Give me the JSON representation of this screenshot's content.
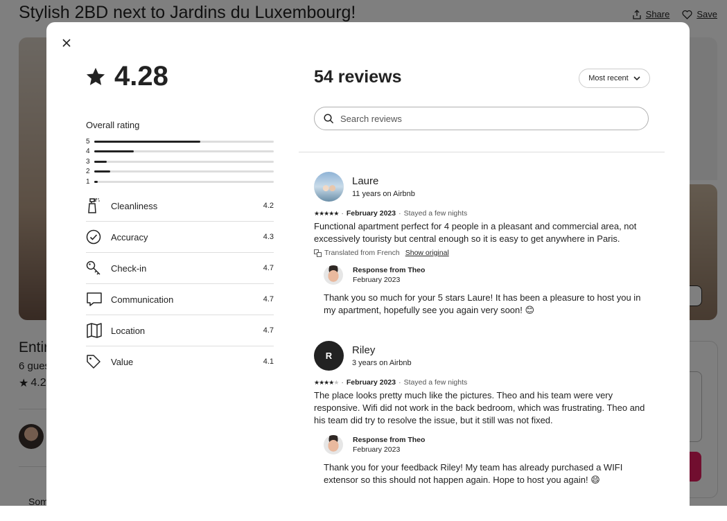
{
  "listing": {
    "title": "Stylish 2BD next to Jardins du Luxembourg!",
    "share_label": "Share",
    "save_label": "Save",
    "heading_partial": "Entir",
    "guests_partial": "6 gues",
    "rating_partial": "4.2",
    "bottom_partial": "Som"
  },
  "modal": {
    "overall_score": "4.28",
    "overall_label": "Overall rating",
    "distribution": [
      {
        "stars": "5",
        "fraction": 0.59
      },
      {
        "stars": "4",
        "fraction": 0.22
      },
      {
        "stars": "3",
        "fraction": 0.07
      },
      {
        "stars": "2",
        "fraction": 0.09
      },
      {
        "stars": "1",
        "fraction": 0.02
      }
    ],
    "categories": [
      {
        "label": "Cleanliness",
        "value": "4.2",
        "icon": "spray-bottle-icon"
      },
      {
        "label": "Accuracy",
        "value": "4.3",
        "icon": "check-circle-icon"
      },
      {
        "label": "Check-in",
        "value": "4.7",
        "icon": "key-icon"
      },
      {
        "label": "Communication",
        "value": "4.7",
        "icon": "chat-bubble-icon"
      },
      {
        "label": "Location",
        "value": "4.7",
        "icon": "map-icon"
      },
      {
        "label": "Value",
        "value": "4.1",
        "icon": "tag-icon"
      }
    ],
    "reviews_title": "54 reviews",
    "sort_label": "Most recent",
    "search_placeholder": "Search reviews",
    "reviews": [
      {
        "name": "Laure",
        "tenure": "11 years on Airbnb",
        "stars": 5,
        "date": "February 2023",
        "stay": "Stayed a few nights",
        "text": "Functional apartment perfect for 4 people in a pleasant and commercial area, not excessively touristy but central enough so it is easy to get anywhere in Paris.",
        "translated": "Translated from French",
        "show_original": "Show original",
        "response_title": "Response from Theo",
        "response_date": "February 2023",
        "response_text": "Thank you so much for your 5 stars Laure! It has been a pleasure to host you in my apartment, hopefully see you again very soon! 😊"
      },
      {
        "name": "Riley",
        "initial": "R",
        "tenure": "3 years on Airbnb",
        "stars": 4,
        "date": "February 2023",
        "stay": "Stayed a few nights",
        "text": "The place looks pretty much like the pictures. Theo and his team were very responsive. Wifi did not work in the back bedroom, which was frustrating. Theo and his team did try to resolve the issue, but it still was not fixed.",
        "response_title": "Response from Theo",
        "response_date": "February 2023",
        "response_text": "Thank you for your feedback Riley! My team has already purchased a WIFI extensor so this should not happen again. Hope to host you again! 😄"
      }
    ]
  }
}
